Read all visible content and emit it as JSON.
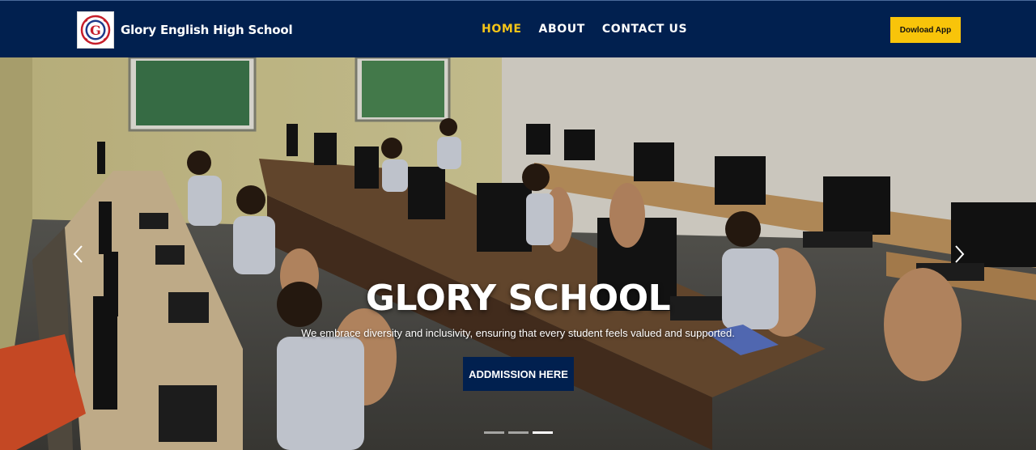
{
  "navbar": {
    "brand_name": "Glory English High School",
    "logo_letter": "G",
    "links": [
      {
        "label": "HOME",
        "active": true
      },
      {
        "label": "ABOUT",
        "active": false
      },
      {
        "label": "CONTACT US",
        "active": false
      }
    ],
    "download_label": "Dowload App"
  },
  "hero": {
    "title": "GLORY SCHOOL",
    "subtitle": "We embrace diversity and inclusivity, ensuring that every student feels valued and supported.",
    "cta_label": "ADDMISSION HERE",
    "prev_icon": "chevron-left-icon",
    "next_icon": "chevron-right-icon",
    "slide_count": 3,
    "active_slide": 3
  },
  "colors": {
    "navbar_bg": "#01204f",
    "active_link": "#f5c518",
    "download_bg": "#f8c40a",
    "cta_bg": "#01204f"
  }
}
